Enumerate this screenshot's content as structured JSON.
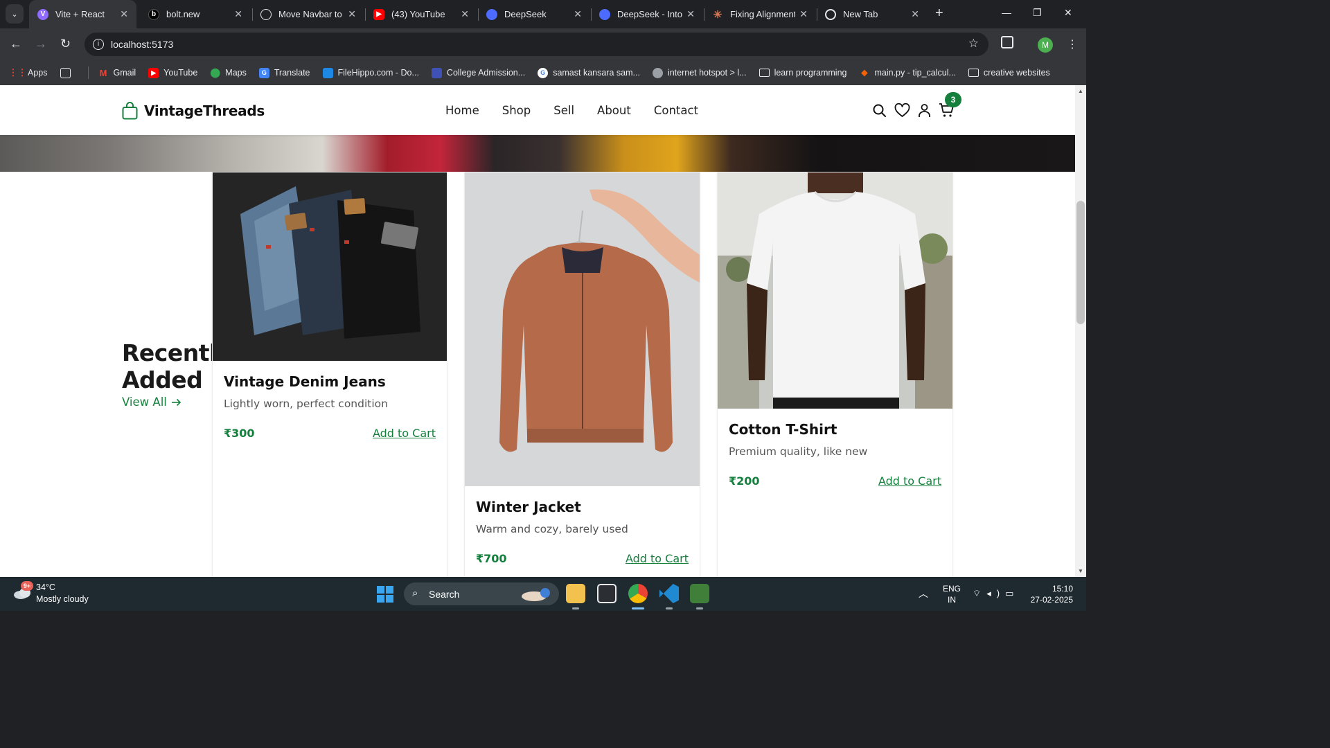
{
  "browser": {
    "tabs": [
      {
        "title": "Vite + React",
        "active": true,
        "icon": "vite-icon",
        "color": "#8f6bff"
      },
      {
        "title": "bolt.new",
        "active": false,
        "icon": "bolt-icon",
        "color": "#000000"
      },
      {
        "title": "Move Navbar to",
        "active": false,
        "icon": "openai-icon",
        "color": "#e8eaed"
      },
      {
        "title": "(43) YouTube",
        "active": false,
        "icon": "youtube-icon",
        "color": "#ff0000"
      },
      {
        "title": "DeepSeek",
        "active": false,
        "icon": "deepseek-icon",
        "color": "#4d6bfe"
      },
      {
        "title": "DeepSeek - Into",
        "active": false,
        "icon": "deepseek-icon",
        "color": "#4d6bfe"
      },
      {
        "title": "Fixing Alignment",
        "active": false,
        "icon": "claude-icon",
        "color": "#d97757"
      },
      {
        "title": "New Tab",
        "active": false,
        "icon": "chrome-icon",
        "color": "#e8eaed"
      }
    ],
    "url": "localhost:5173",
    "profile_initial": "M",
    "bookmarks": [
      {
        "label": "Apps",
        "icon": "apps-grid-icon",
        "color": "#ea4335"
      },
      {
        "label": "Gmail",
        "icon": "gmail-icon",
        "color": "#ea4335"
      },
      {
        "label": "YouTube",
        "icon": "youtube-icon",
        "color": "#ff0000"
      },
      {
        "label": "Maps",
        "icon": "maps-icon",
        "color": "#34a853"
      },
      {
        "label": "Translate",
        "icon": "translate-icon",
        "color": "#4285f4"
      },
      {
        "label": "FileHippo.com - Do...",
        "icon": "filehippo-icon",
        "color": "#1e88e5"
      },
      {
        "label": "College Admission...",
        "icon": "college-icon",
        "color": "#3f51b5"
      },
      {
        "label": "samast kansara sam...",
        "icon": "google-icon",
        "color": "#ffffff"
      },
      {
        "label": "internet hotspot > l...",
        "icon": "globe-icon",
        "color": "#9aa0a6"
      },
      {
        "label": "learn programming",
        "icon": "folder-icon",
        "color": "#e8eaed"
      },
      {
        "label": "main.py - tip_calcul...",
        "icon": "replit-icon",
        "color": "#f26207"
      },
      {
        "label": "creative websites",
        "icon": "folder-icon",
        "color": "#e8eaed"
      }
    ]
  },
  "site": {
    "brand": "VintageThreads",
    "accent": "#15803d",
    "nav": [
      "Home",
      "Shop",
      "Sell",
      "About",
      "Contact"
    ],
    "cart_count": "3",
    "section": {
      "title_line1": "Recently",
      "title_line2": "Added",
      "view_all": "View All",
      "products": [
        {
          "name": "Vintage Denim Jeans",
          "description": "Lightly worn, perfect condition",
          "price": "₹300",
          "cta": "Add to Cart"
        },
        {
          "name": "Winter Jacket",
          "description": "Warm and cozy, barely used",
          "price": "₹700",
          "cta": "Add to Cart"
        },
        {
          "name": "Cotton T-Shirt",
          "description": "Premium quality, like new",
          "price": "₹200",
          "cta": "Add to Cart"
        }
      ]
    }
  },
  "taskbar": {
    "weather_badge": "9+",
    "temperature": "34°C",
    "condition": "Mostly cloudy",
    "search_label": "Search",
    "lang_line1": "ENG",
    "lang_line2": "IN",
    "time": "15:10",
    "date": "27-02-2025"
  }
}
